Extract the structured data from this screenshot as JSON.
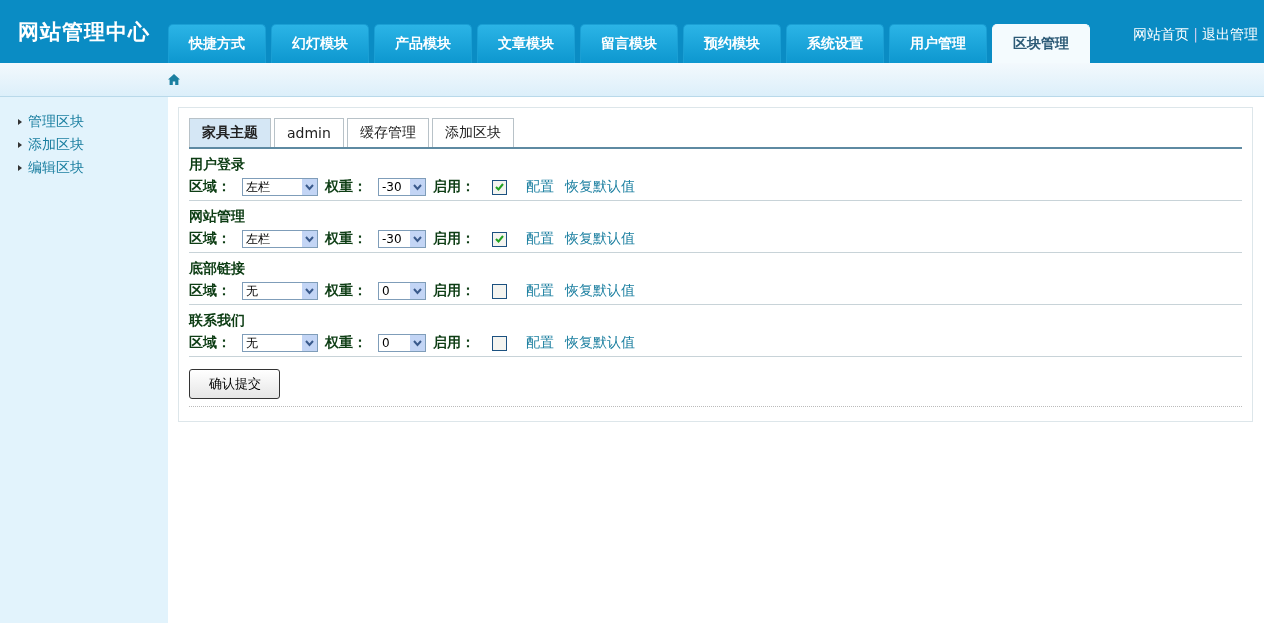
{
  "header": {
    "title": "网站管理中心",
    "nav_tabs": [
      {
        "label": "快捷方式",
        "selected": false
      },
      {
        "label": "幻灯模块",
        "selected": false
      },
      {
        "label": "产品模块",
        "selected": false
      },
      {
        "label": "文章模块",
        "selected": false
      },
      {
        "label": "留言模块",
        "selected": false
      },
      {
        "label": "预约模块",
        "selected": false
      },
      {
        "label": "系统设置",
        "selected": false
      },
      {
        "label": "用户管理",
        "selected": false
      },
      {
        "label": "区块管理",
        "selected": true
      }
    ],
    "links": [
      "网站首页",
      "退出管理"
    ],
    "separator": "|"
  },
  "sidebar": {
    "items": [
      "管理区块",
      "添加区块",
      "编辑区块"
    ]
  },
  "content": {
    "tabs": [
      {
        "label": "家具主题",
        "selected": true
      },
      {
        "label": "admin",
        "selected": false
      },
      {
        "label": "缓存管理",
        "selected": false
      },
      {
        "label": "添加区块",
        "selected": false
      }
    ],
    "blocks": [
      {
        "title": "用户登录",
        "region_label": "区域：",
        "region": "左栏",
        "weight_label": "权重：",
        "weight": "-30",
        "enabled_label": "启用：",
        "enabled": true,
        "links": [
          "配置",
          "恢复默认值"
        ]
      },
      {
        "title": "网站管理",
        "region_label": "区域：",
        "region": "左栏",
        "weight_label": "权重：",
        "weight": "-30",
        "enabled_label": "启用：",
        "enabled": true,
        "links": [
          "配置",
          "恢复默认值"
        ]
      },
      {
        "title": "底部链接",
        "region_label": "区域：",
        "region": "无",
        "weight_label": "权重：",
        "weight": "0",
        "enabled_label": "启用：",
        "enabled": false,
        "links": [
          "配置",
          "恢复默认值"
        ]
      },
      {
        "title": "联系我们",
        "region_label": "区域：",
        "region": "无",
        "weight_label": "权重：",
        "weight": "0",
        "enabled_label": "启用：",
        "enabled": false,
        "links": [
          "配置",
          "恢复默认值"
        ]
      }
    ],
    "submit": "确认提交"
  }
}
